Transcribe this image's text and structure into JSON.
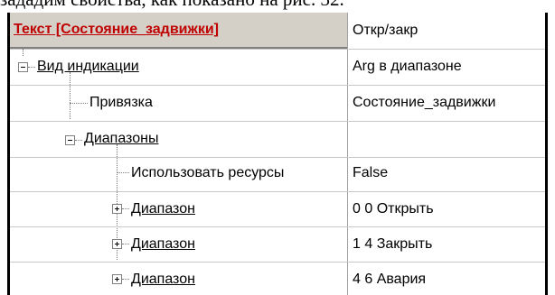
{
  "caption": "зададим свойства, как показано на рис. 32.",
  "grid": {
    "header": {
      "name": "Текст [Состояние_задвижки]",
      "value": "Откр/закр"
    },
    "rows": [
      {
        "name": "Вид индикации",
        "value": "Arg в диапазоне",
        "state": "expanded"
      },
      {
        "name": "Привязка",
        "value": "Состояние_задвижки"
      },
      {
        "name": "Диапазоны",
        "value": "",
        "state": "expanded"
      },
      {
        "name": "Использовать ресурсы",
        "value": "False"
      },
      {
        "name": "Диапазон",
        "value": "0 0 Открыть",
        "state": "collapsed"
      },
      {
        "name": "Диапазон",
        "value": "1 4 Закрыть",
        "state": "collapsed"
      },
      {
        "name": "Диапазон",
        "value": "4 6 Авария",
        "state": "collapsed"
      }
    ]
  }
}
